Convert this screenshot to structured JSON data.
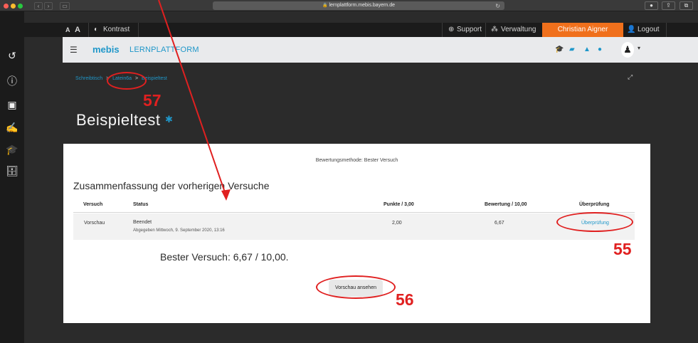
{
  "browser": {
    "url": "lernplattform.mebis.bayern.de"
  },
  "utilbar": {
    "font_small": "A",
    "font_large": "A",
    "contrast": "Kontrast",
    "support": "Support",
    "admin": "Verwaltung",
    "user": "Christian Aigner",
    "logout": "Logout"
  },
  "header": {
    "logo": "mebis",
    "logo_text": "LERNPLATTFORM"
  },
  "breadcrumb": [
    "Schreibtisch",
    ">",
    "Latein6a",
    ">",
    "Beispieltest"
  ],
  "page": {
    "title": "Beispieltest"
  },
  "quiz": {
    "grading_method": "Bewertungsmethode: Bester Versuch",
    "summary_title": "Zusammenfassung der vorherigen Versuche",
    "columns": [
      "Versuch",
      "Status",
      "Punkte / 3,00",
      "Bewertung / 10,00",
      "Überprüfung"
    ],
    "attempts": [
      {
        "attempt": "Vorschau",
        "status": "Beendet",
        "submitted": "Abgegeben Mittwoch, 9. September 2020, 13:16",
        "points": "2,00",
        "grade": "6,67",
        "review": "Überprüfung"
      }
    ],
    "best_attempt": "Bester Versuch: 6,67 / 10,00.",
    "preview_button": "Vorschau ansehen"
  },
  "annotations": {
    "label_55": "55",
    "label_56": "56",
    "label_57": "57",
    "color": "#e02020"
  },
  "colors": {
    "accent": "#1f97c9",
    "user_button": "#f0701c"
  }
}
